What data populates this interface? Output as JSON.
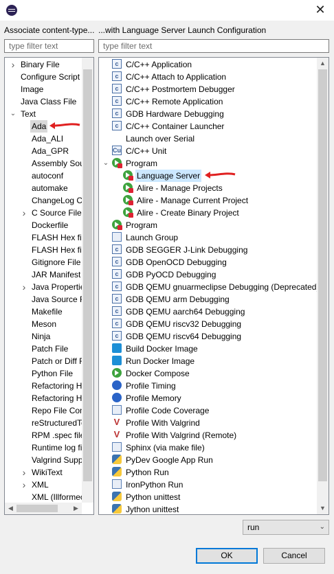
{
  "dialog": {
    "left_header": "Associate content-type...",
    "right_header": "...with Language Server Launch Configuration",
    "left_filter_placeholder": "type filter text",
    "right_filter_placeholder": "type filter text"
  },
  "left_tree": [
    {
      "label": "Binary File",
      "exp": "right",
      "level": 0
    },
    {
      "label": "Configure Script",
      "exp": "",
      "level": 0
    },
    {
      "label": "Image",
      "exp": "",
      "level": 0
    },
    {
      "label": "Java Class File",
      "exp": "",
      "level": 0
    },
    {
      "label": "Text",
      "exp": "down",
      "level": 0
    },
    {
      "label": "Ada",
      "exp": "",
      "level": 1,
      "highlight": true
    },
    {
      "label": "Ada_ALI",
      "exp": "",
      "level": 1
    },
    {
      "label": "Ada_GPR",
      "exp": "",
      "level": 1
    },
    {
      "label": "Assembly Sour",
      "exp": "",
      "level": 1
    },
    {
      "label": "autoconf",
      "exp": "",
      "level": 1
    },
    {
      "label": "automake",
      "exp": "",
      "level": 1
    },
    {
      "label": "ChangeLog Co",
      "exp": "",
      "level": 1
    },
    {
      "label": "C Source File",
      "exp": "right",
      "level": 1
    },
    {
      "label": "Dockerfile",
      "exp": "",
      "level": 1
    },
    {
      "label": "FLASH Hex file",
      "exp": "",
      "level": 1
    },
    {
      "label": "FLASH Hex file",
      "exp": "",
      "level": 1
    },
    {
      "label": "Gitignore File",
      "exp": "",
      "level": 1
    },
    {
      "label": "JAR Manifest F",
      "exp": "",
      "level": 1
    },
    {
      "label": "Java Properties",
      "exp": "right",
      "level": 1
    },
    {
      "label": "Java Source Fil",
      "exp": "",
      "level": 1
    },
    {
      "label": "Makefile",
      "exp": "",
      "level": 1
    },
    {
      "label": "Meson",
      "exp": "",
      "level": 1
    },
    {
      "label": "Ninja",
      "exp": "",
      "level": 1
    },
    {
      "label": "Patch File",
      "exp": "",
      "level": 1
    },
    {
      "label": "Patch or Diff F",
      "exp": "",
      "level": 1
    },
    {
      "label": "Python File",
      "exp": "",
      "level": 1
    },
    {
      "label": "Refactoring Hi",
      "exp": "",
      "level": 1
    },
    {
      "label": "Refactoring Hi",
      "exp": "",
      "level": 1
    },
    {
      "label": "Repo File Cont",
      "exp": "",
      "level": 1
    },
    {
      "label": "reStructuredTe",
      "exp": "",
      "level": 1
    },
    {
      "label": "RPM .spec file",
      "exp": "",
      "level": 1
    },
    {
      "label": "Runtime log fi",
      "exp": "",
      "level": 1
    },
    {
      "label": "Valgrind Suppr",
      "exp": "",
      "level": 1
    },
    {
      "label": "WikiText",
      "exp": "right",
      "level": 1
    },
    {
      "label": "XML",
      "exp": "right",
      "level": 1
    },
    {
      "label": "XML (Illformec",
      "exp": "",
      "level": 1
    }
  ],
  "right_tree": [
    {
      "label": "C/C++ Application",
      "icon": "c-icon",
      "level": 0
    },
    {
      "label": "C/C++ Attach to Application",
      "icon": "c-icon",
      "level": 0
    },
    {
      "label": "C/C++ Postmortem Debugger",
      "icon": "c-icon",
      "level": 0
    },
    {
      "label": "C/C++ Remote Application",
      "icon": "c-icon",
      "level": 0
    },
    {
      "label": "GDB Hardware Debugging",
      "icon": "c-icon",
      "level": 0
    },
    {
      "label": "C/C++ Container Launcher",
      "icon": "c-icon",
      "level": 0
    },
    {
      "label": "Launch over Serial",
      "icon": "none",
      "level": 0
    },
    {
      "label": "C/C++ Unit",
      "icon": "cu-icon",
      "level": 0
    },
    {
      "label": "Program",
      "icon": "run-icon",
      "level": 0,
      "exp": "down"
    },
    {
      "label": "Language Server",
      "icon": "run-icon",
      "level": 1,
      "selected": true
    },
    {
      "label": "Alire - Manage Projects",
      "icon": "run-icon",
      "level": 1
    },
    {
      "label": "Alire - Manage Current Project",
      "icon": "run-icon",
      "level": 1
    },
    {
      "label": "Alire - Create Binary Project",
      "icon": "run-icon",
      "level": 1
    },
    {
      "label": "Program",
      "icon": "run-icon",
      "level": 0
    },
    {
      "label": "Launch Group",
      "icon": "launch-group-icon",
      "level": 0
    },
    {
      "label": "GDB SEGGER J-Link Debugging",
      "icon": "c-icon",
      "level": 0
    },
    {
      "label": "GDB OpenOCD Debugging",
      "icon": "c-icon",
      "level": 0
    },
    {
      "label": "GDB PyOCD Debugging",
      "icon": "c-icon",
      "level": 0
    },
    {
      "label": "GDB QEMU gnuarmeclipse Debugging (Deprecated)",
      "icon": "c-icon",
      "level": 0
    },
    {
      "label": "GDB QEMU arm Debugging",
      "icon": "c-icon",
      "level": 0
    },
    {
      "label": "GDB QEMU aarch64 Debugging",
      "icon": "c-icon",
      "level": 0
    },
    {
      "label": "GDB QEMU riscv32 Debugging",
      "icon": "c-icon",
      "level": 0
    },
    {
      "label": "GDB QEMU riscv64 Debugging",
      "icon": "c-icon",
      "level": 0
    },
    {
      "label": "Build Docker Image",
      "icon": "docker-icon",
      "level": 0
    },
    {
      "label": "Run Docker Image",
      "icon": "docker-icon",
      "level": 0
    },
    {
      "label": "Docker Compose",
      "icon": "compose-icon",
      "level": 0
    },
    {
      "label": "Profile Timing",
      "icon": "timing-icon",
      "level": 0
    },
    {
      "label": "Profile Memory",
      "icon": "memory-icon",
      "level": 0
    },
    {
      "label": "Profile Code Coverage",
      "icon": "coverage-icon",
      "level": 0
    },
    {
      "label": "Profile With Valgrind",
      "icon": "valgrind-icon",
      "level": 0
    },
    {
      "label": "Profile With Valgrind (Remote)",
      "icon": "valgrind-icon",
      "level": 0
    },
    {
      "label": "Sphinx (via make file)",
      "icon": "sphinx-icon",
      "level": 0
    },
    {
      "label": "PyDev Google App Run",
      "icon": "pydev-icon",
      "level": 0
    },
    {
      "label": "Python Run",
      "icon": "python-icon",
      "level": 0
    },
    {
      "label": "IronPython Run",
      "icon": "ironpython-icon",
      "level": 0
    },
    {
      "label": "Python unittest",
      "icon": "python-icon",
      "level": 0
    },
    {
      "label": "Jython unittest",
      "icon": "jython-icon",
      "level": 0
    }
  ],
  "mode_select": {
    "value": "run"
  },
  "buttons": {
    "ok": "OK",
    "cancel": "Cancel"
  },
  "annotations": {
    "arrow_color": "#e02020"
  }
}
